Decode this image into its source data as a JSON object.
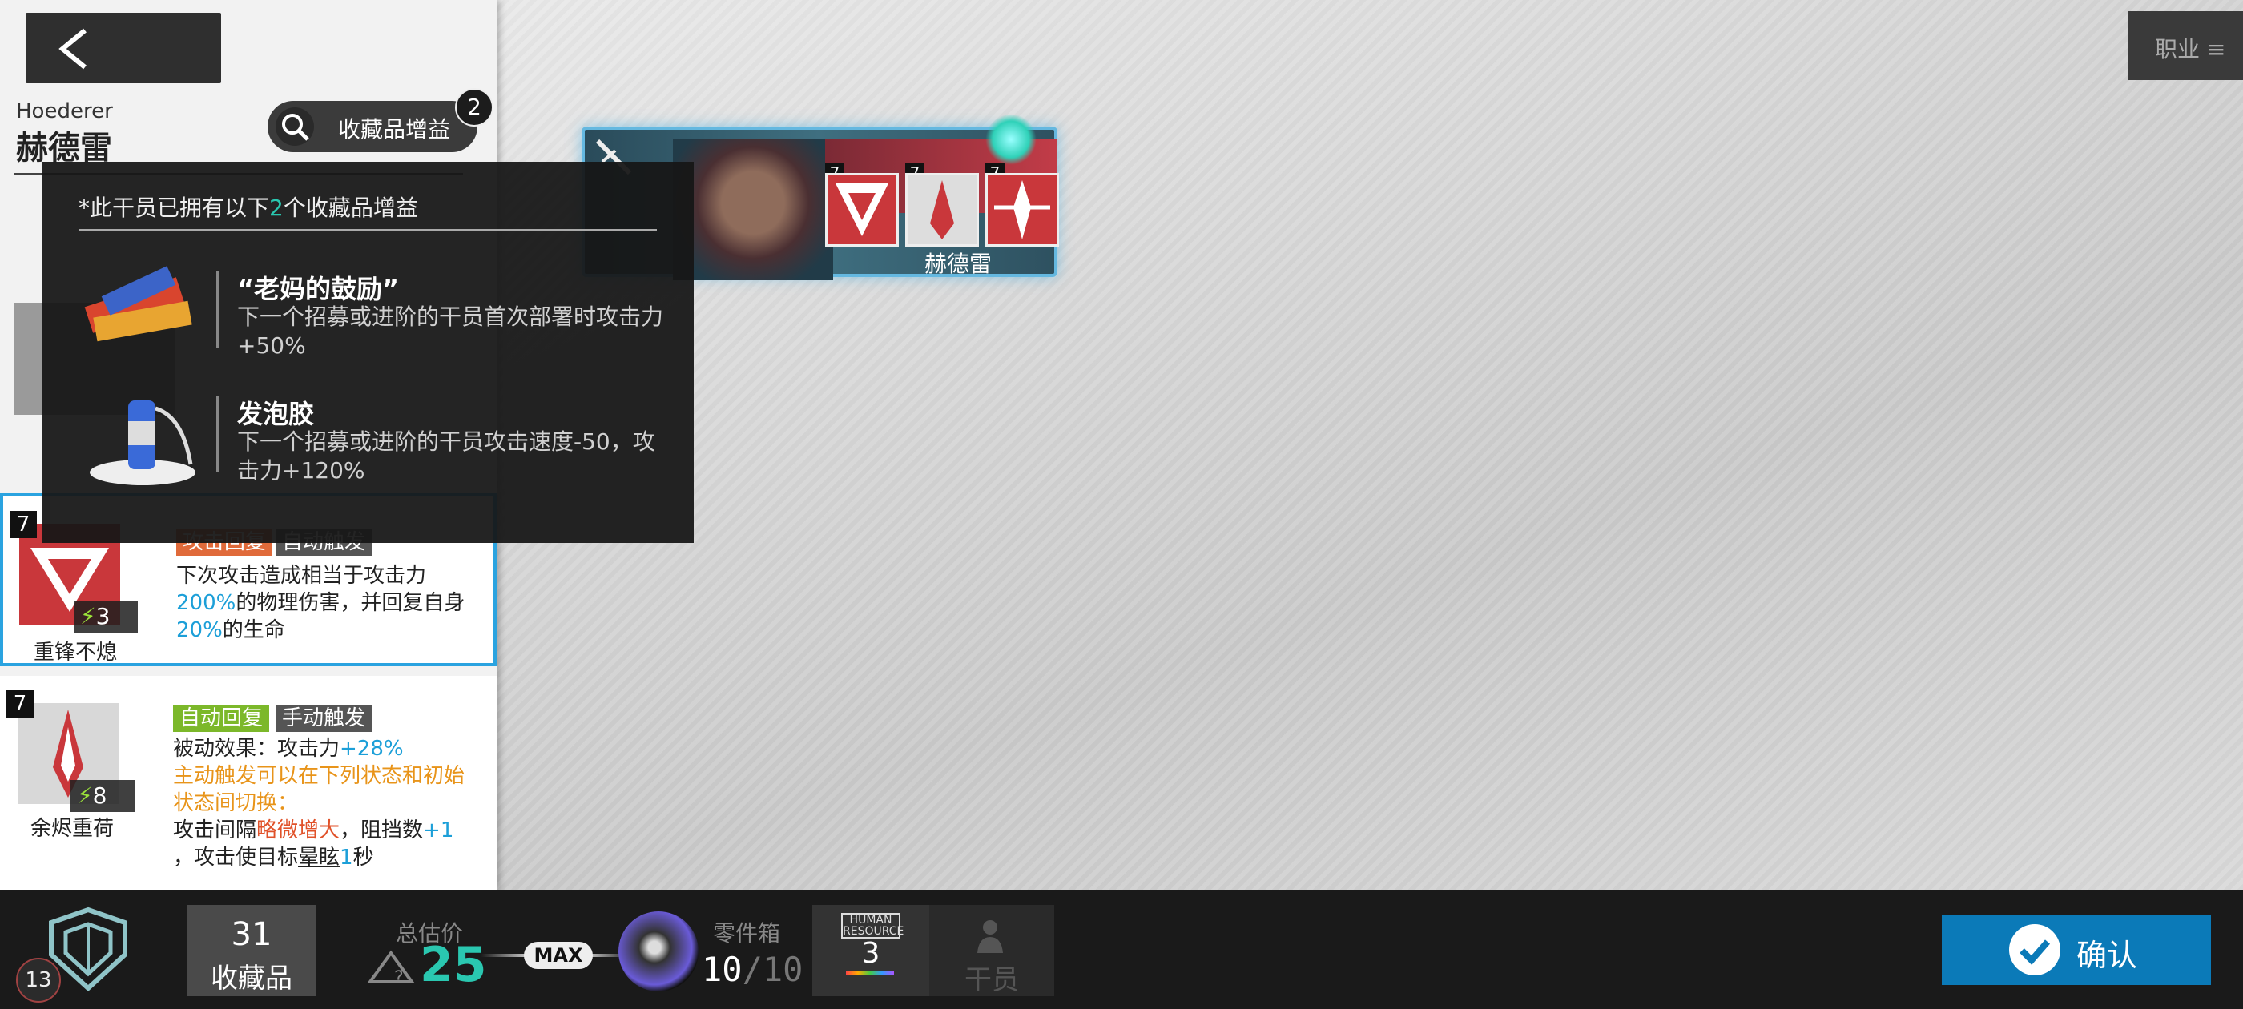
{
  "operator": {
    "name_en": "Hoederer",
    "name_cn": "赫德雷"
  },
  "bonus_button": {
    "label": "收藏品增益",
    "count": "2"
  },
  "tooltip": {
    "title_pre": "*此干员已拥有以下",
    "title_num": "2",
    "title_post": "个收藏品增益",
    "relics": [
      {
        "name": "“老妈的鼓励”",
        "desc": "下一个招募或进阶的干员首次部署时攻击力+50%"
      },
      {
        "name": "发泡胶",
        "desc": "下一个招募或进阶的干员攻击速度-50，攻击力+120%"
      }
    ]
  },
  "skills": [
    {
      "level": "7",
      "sp": "3",
      "name": "重锋不熄",
      "tags": [
        "攻击回复",
        "自动触发"
      ],
      "desc": {
        "a": "下次攻击造成相当于攻击力",
        "b": "200%",
        "c": "的物理伤害，并回复自身",
        "d": "20%",
        "e": "的生命"
      }
    },
    {
      "level": "7",
      "sp": "8",
      "name": "余烬重荷",
      "tags": [
        "自动回复",
        "手动触发"
      ],
      "desc": {
        "l1a": "被动效果：攻击力",
        "l1b": "+28%",
        "l2": "主动触发可以在下列状态和初始状态间切换：",
        "l3a": "攻击间隔",
        "l3b": "略微增大",
        "l3c": "，阻挡数",
        "l3d": "+1",
        "l4a": "，攻击使目标",
        "l4b": "晕眩",
        "l4c": "1",
        "l4d": "秒"
      }
    }
  ],
  "card": {
    "name": "赫德雷",
    "skill_levels": [
      "7",
      "7",
      "7"
    ]
  },
  "class_filter": {
    "label": "职业 ≡"
  },
  "bottom": {
    "level": "13",
    "collectibles_count": "31",
    "collectibles_label": "收藏品",
    "value_label": "总估价",
    "value": "25",
    "max_label": "MAX",
    "parts_label": "零件箱",
    "parts_current": "10",
    "parts_max": "/10",
    "hr_title": "HUMAN RESOURCE",
    "hr_count": "3",
    "staff_label": "干员",
    "confirm_label": "确认"
  }
}
